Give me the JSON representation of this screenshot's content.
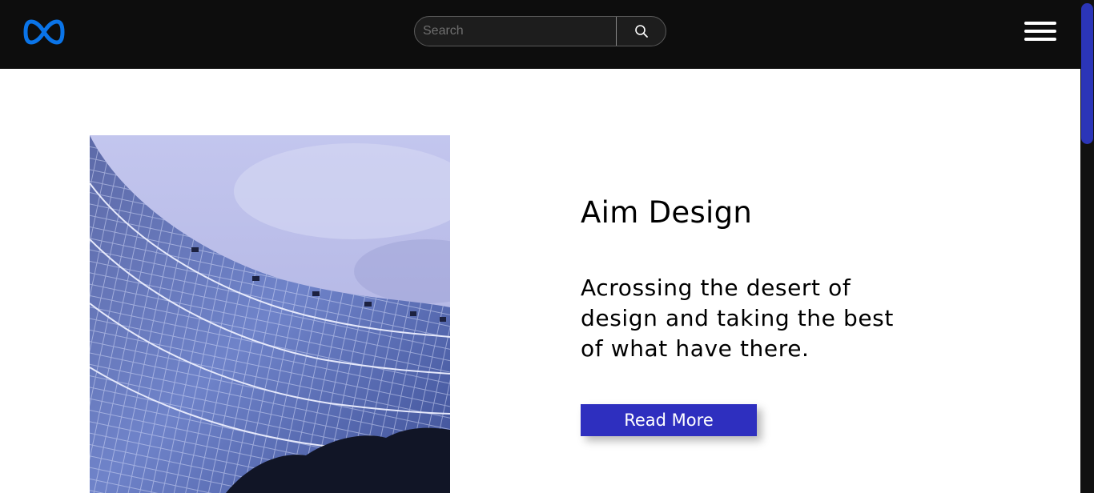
{
  "header": {
    "logo_icon": "meta-infinity-logo-icon",
    "search": {
      "placeholder": "Search",
      "value": "",
      "button_icon": "search-icon"
    },
    "menu_icon": "hamburger-menu-icon"
  },
  "hero": {
    "title": "Aim Design",
    "description": "Acrossing the desert of design and taking the best of what have there.",
    "button_label": "Read More",
    "image_subject": "curved glass office building against cloudy sky"
  },
  "colors": {
    "navbar_bg": "#0d0d0d",
    "logo": "#0a74e8",
    "button_bg": "#2e2fbf",
    "scroll_thumb": "#2b35b8"
  }
}
